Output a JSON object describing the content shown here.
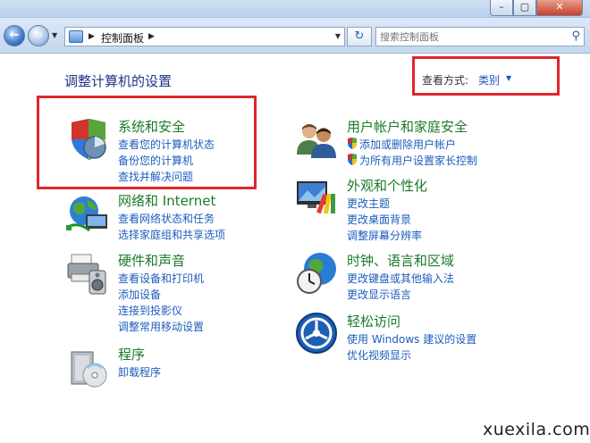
{
  "window": {
    "min_label": "–",
    "max_label": "▢",
    "close_label": "✕"
  },
  "address": {
    "crumb": "控制面板",
    "search_placeholder": "搜索控制面板"
  },
  "page": {
    "title": "调整计算机的设置",
    "view_by_label": "查看方式:",
    "view_by_value": "类别"
  },
  "categories": {
    "security": {
      "title": "系统和安全",
      "links": [
        "查看您的计算机状态",
        "备份您的计算机",
        "查找并解决问题"
      ]
    },
    "network": {
      "title": "网络和 Internet",
      "links": [
        "查看网络状态和任务",
        "选择家庭组和共享选项"
      ]
    },
    "hardware": {
      "title": "硬件和声音",
      "links": [
        "查看设备和打印机",
        "添加设备",
        "连接到投影仪",
        "调整常用移动设置"
      ]
    },
    "programs": {
      "title": "程序",
      "links": [
        "卸载程序"
      ]
    },
    "users": {
      "title": "用户帐户和家庭安全",
      "links": [
        "添加或删除用户帐户",
        "为所有用户设置家长控制"
      ]
    },
    "appearance": {
      "title": "外观和个性化",
      "links": [
        "更改主题",
        "更改桌面背景",
        "调整屏幕分辨率"
      ]
    },
    "clock": {
      "title": "时钟、语言和区域",
      "links": [
        "更改键盘或其他输入法",
        "更改显示语言"
      ]
    },
    "ease": {
      "title": "轻松访问",
      "links": [
        "使用 Windows 建议的设置",
        "优化视频显示"
      ]
    }
  },
  "watermark": "xuexila.com",
  "colors": {
    "category_title": "#1b7a29",
    "link": "#1c5cbd",
    "page_title": "#1e3287",
    "highlight_box": "#e1262b"
  }
}
